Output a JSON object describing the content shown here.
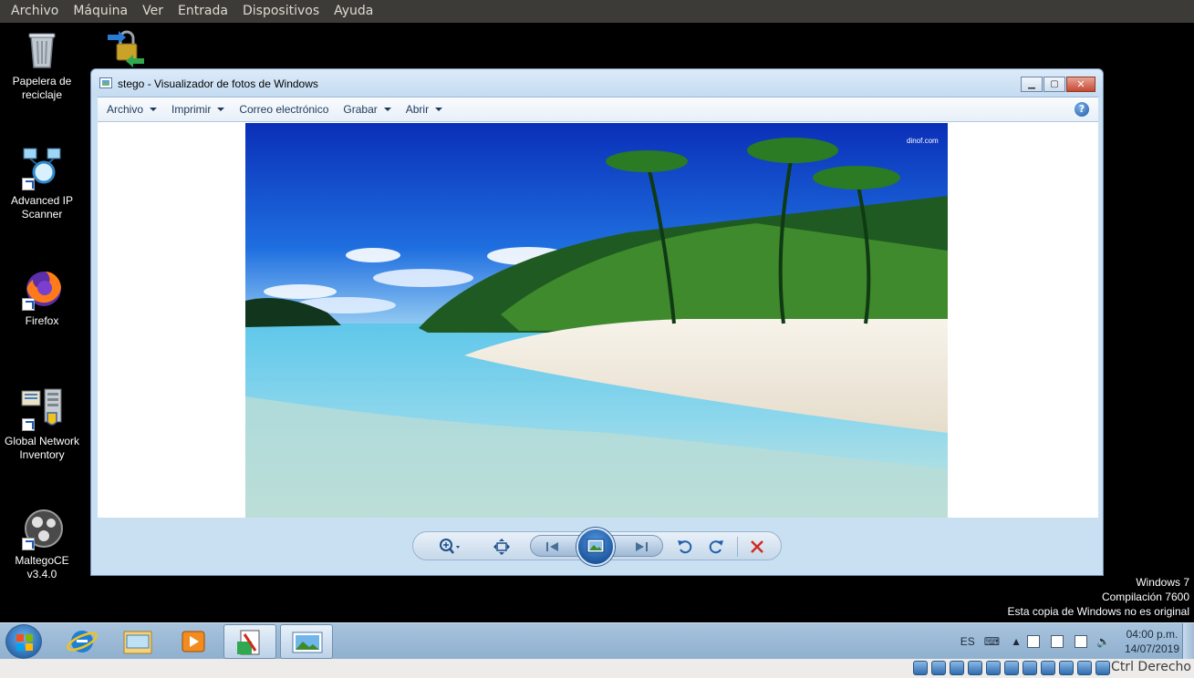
{
  "host_menubar": {
    "items": [
      "Archivo",
      "Máquina",
      "Ver",
      "Entrada",
      "Dispositivos",
      "Ayuda"
    ]
  },
  "desktop": {
    "icons": [
      {
        "label": "Papelera de reciclaje",
        "icon": "recycle-bin-icon"
      },
      {
        "label": "Advanced IP Scanner",
        "icon": "network-scanner-icon"
      },
      {
        "label": "Firefox",
        "icon": "firefox-icon"
      },
      {
        "label": "Global Network Inventory",
        "icon": "network-inventory-icon"
      },
      {
        "label": "MaltegoCE v3.4.0",
        "icon": "maltego-icon"
      },
      {
        "label": "",
        "icon": "lock-network-icon"
      }
    ]
  },
  "photo_viewer": {
    "title": "stego - Visualizador de fotos de Windows",
    "toolbar": [
      {
        "label": "Archivo",
        "has_dropdown": true
      },
      {
        "label": "Imprimir",
        "has_dropdown": true
      },
      {
        "label": "Correo electrónico",
        "has_dropdown": false
      },
      {
        "label": "Grabar",
        "has_dropdown": true
      },
      {
        "label": "Abrir",
        "has_dropdown": true
      }
    ],
    "help_label": "?",
    "image": {
      "description_icon": "tropical-beach-photo",
      "watermark_text": "dinof.com"
    },
    "controls": [
      "zoom",
      "actual-size",
      "previous",
      "slideshow",
      "next",
      "rotate-left",
      "rotate-right",
      "delete"
    ]
  },
  "watermark": {
    "line1": "Windows 7",
    "line2": "Compilación  7600",
    "line3": "Esta copia de Windows no es original"
  },
  "taskbar": {
    "apps": [
      "internet-explorer-icon",
      "file-explorer-icon",
      "media-player-icon",
      "paint-icon",
      "photo-viewer-icon"
    ],
    "language": "ES",
    "time": "04:00 p.m.",
    "date": "14/07/2019"
  },
  "vb_status": {
    "host_key": "Ctrl Derecho"
  },
  "colors": {
    "host_menubar": "#3c3b37",
    "window_frame": "#c9dff2",
    "taskbar": "#a8c3dd",
    "close_button": "#c74a33"
  }
}
